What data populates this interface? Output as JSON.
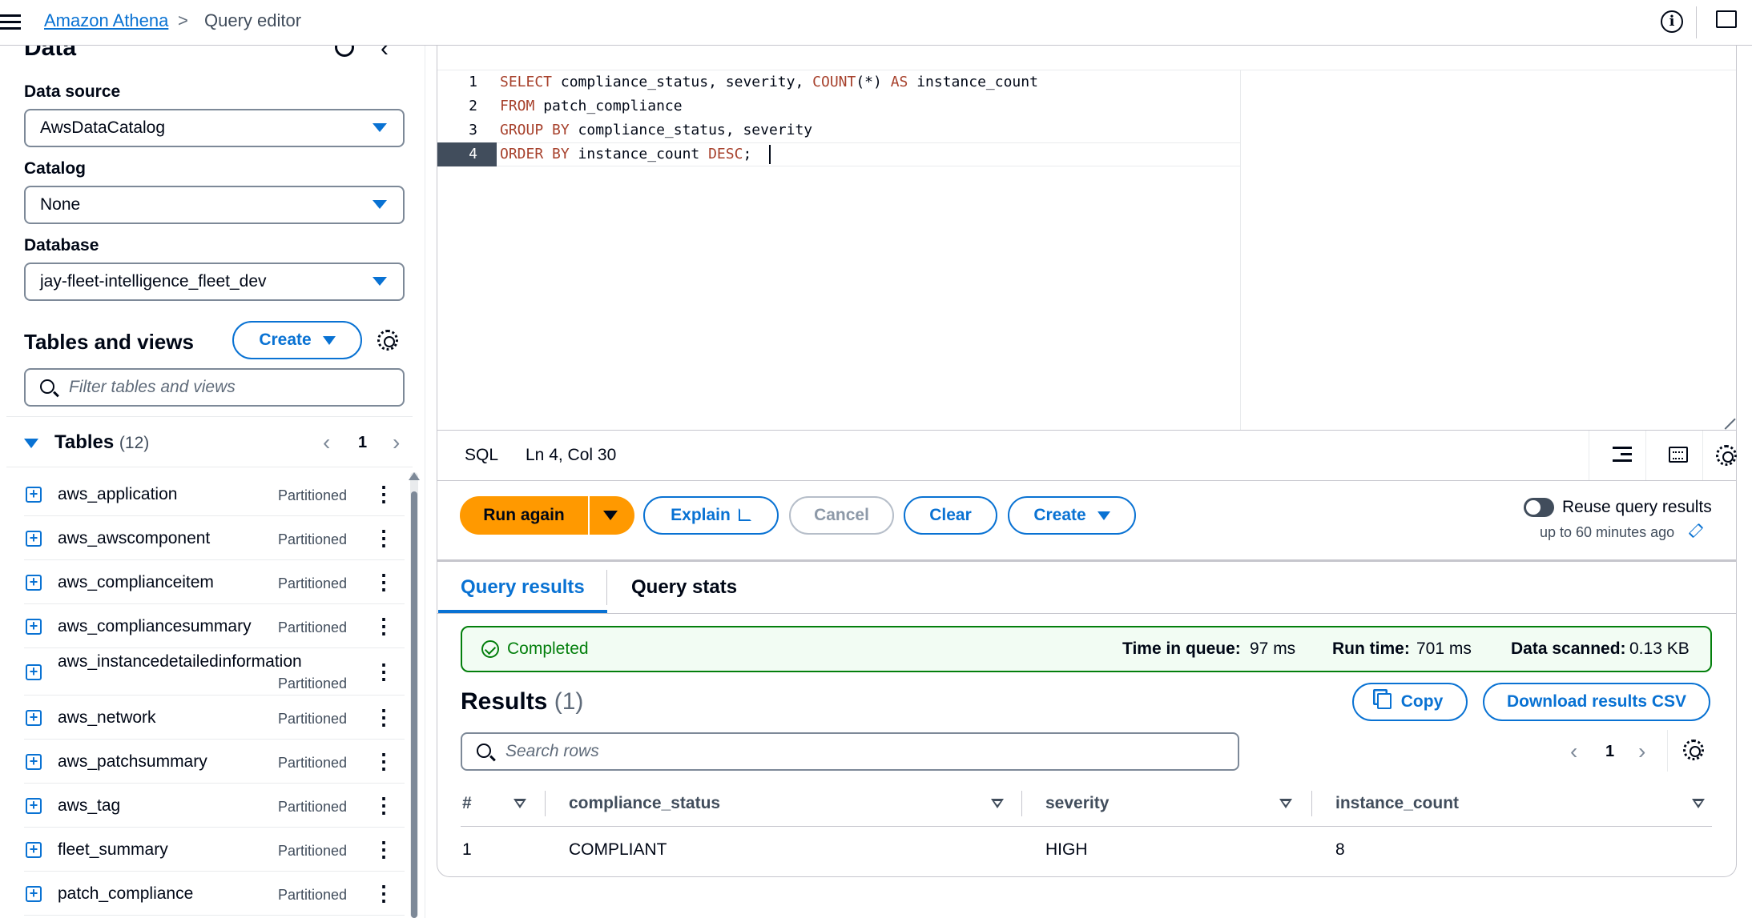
{
  "header": {
    "breadcrumb_root": "Amazon Athena",
    "breadcrumb_separator": ">",
    "breadcrumb_current": "Query editor",
    "info_icon": "i"
  },
  "sidebar": {
    "title": "Data",
    "collapse_glyph": "‹",
    "data_source_label": "Data source",
    "data_source_value": "AwsDataCatalog",
    "catalog_label": "Catalog",
    "catalog_value": "None",
    "database_label": "Database",
    "database_value": "jay-fleet-intelligence_fleet_dev",
    "tables_and_views_title": "Tables and views",
    "create_label": "Create",
    "filter_placeholder": "Filter tables and views",
    "tables_label": "Tables",
    "tables_count": "(12)",
    "page": "1",
    "prev_glyph": "‹",
    "next_glyph": "›",
    "tables": [
      {
        "name": "aws_application",
        "tag": "Partitioned"
      },
      {
        "name": "aws_awscomponent",
        "tag": "Partitioned"
      },
      {
        "name": "aws_complianceitem",
        "tag": "Partitioned"
      },
      {
        "name": "aws_compliancesummary",
        "tag": "Partitioned"
      },
      {
        "name": "aws_instancedetailedinformation",
        "tag": "Partitioned"
      },
      {
        "name": "aws_network",
        "tag": "Partitioned"
      },
      {
        "name": "aws_patchsummary",
        "tag": "Partitioned"
      },
      {
        "name": "aws_tag",
        "tag": "Partitioned"
      },
      {
        "name": "fleet_summary",
        "tag": "Partitioned"
      },
      {
        "name": "patch_compliance",
        "tag": "Partitioned"
      }
    ],
    "plus_glyph": "+",
    "more_glyph": "⋮"
  },
  "editor": {
    "line_numbers": [
      "1",
      "2",
      "3",
      "4"
    ],
    "lines": [
      {
        "kw1": "SELECT",
        "t1": " compliance_status, severity, ",
        "kw2": "COUNT",
        "t2": "(*) ",
        "kw3": "AS",
        "t3": " instance_count"
      },
      {
        "kw1": "FROM",
        "t1": " patch_compliance",
        "kw2": "",
        "t2": "",
        "kw3": "",
        "t3": ""
      },
      {
        "kw1": "GROUP BY",
        "t1": " compliance_status, severity",
        "kw2": "",
        "t2": "",
        "kw3": "",
        "t3": ""
      },
      {
        "kw1": "ORDER BY",
        "t1": " instance_count ",
        "kw2": "DESC",
        "t2": ";",
        "kw3": "",
        "t3": ""
      }
    ],
    "language": "SQL",
    "cursor_position": "Ln 4, Col 30"
  },
  "actions": {
    "run_again": "Run again",
    "explain": "Explain",
    "cancel": "Cancel",
    "clear": "Clear",
    "create": "Create",
    "reuse_label": "Reuse query results",
    "reuse_sub": "up to 60 minutes ago",
    "reuse_enabled": false
  },
  "results": {
    "tab_results": "Query results",
    "tab_stats": "Query stats",
    "status": "Completed",
    "queue_label": "Time in queue:",
    "queue_value": "97 ms",
    "run_label": "Run time:",
    "run_value": "701 ms",
    "scanned_label": "Data scanned:",
    "scanned_value": "0.13 KB",
    "title": "Results",
    "count": "(1)",
    "copy": "Copy",
    "download": "Download results CSV",
    "search_placeholder": "Search rows",
    "page": "1",
    "prev_glyph": "‹",
    "next_glyph": "›",
    "columns": [
      "#",
      "compliance_status",
      "severity",
      "instance_count"
    ],
    "rows": [
      [
        "1",
        "COMPLIANT",
        "HIGH",
        "8"
      ]
    ]
  },
  "colors": {
    "accent": "#0972d3",
    "run_button": "#ff9900",
    "success": "#037f0c",
    "keyword": "#a7412c"
  }
}
